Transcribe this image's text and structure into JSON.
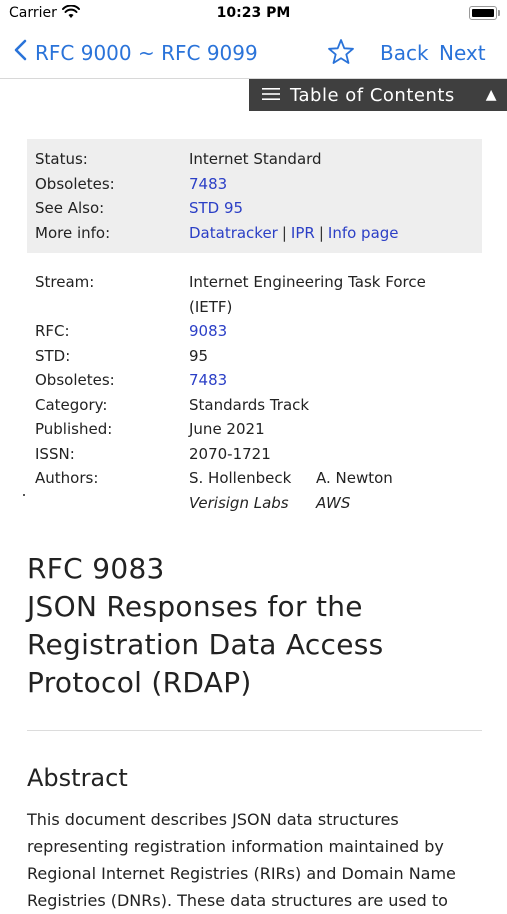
{
  "status_bar": {
    "carrier": "Carrier",
    "time": "10:23 PM"
  },
  "nav": {
    "range_title": "RFC 9000 ~ RFC 9099",
    "back": "Back",
    "next": "Next"
  },
  "toc": {
    "label": "Table of Contents"
  },
  "meta1": {
    "status_label": "Status:",
    "status_value": "Internet Standard",
    "obsoletes_label": "Obsoletes:",
    "obsoletes_value": "7483",
    "see_also_label": "See Also:",
    "see_also_value": "STD 95",
    "more_info_label": "More info:",
    "datatracker": "Datatracker",
    "ipr": "IPR",
    "info_page": "Info page",
    "separator": "|"
  },
  "meta2": {
    "stream_label": "Stream:",
    "stream_value_line1": "Internet Engineering Task Force",
    "stream_value_line2": "(IETF)",
    "rfc_label": "RFC:",
    "rfc_value": "9083",
    "std_label": "STD:",
    "std_value": "95",
    "obsoletes_label": "Obsoletes:",
    "obsoletes_value": "7483",
    "category_label": "Category:",
    "category_value": "Standards Track",
    "published_label": "Published:",
    "published_value": "June 2021",
    "issn_label": "ISSN:",
    "issn_value": "2070-1721",
    "authors_label": "Authors:",
    "authors": [
      {
        "name": "S. Hollenbeck",
        "org": "Verisign Labs"
      },
      {
        "name": "A. Newton",
        "org": "AWS"
      }
    ]
  },
  "doc": {
    "title_line1": "RFC 9083",
    "title_line2": "JSON Responses for the",
    "title_line3": "Registration Data Access",
    "title_line4": "Protocol (RDAP)",
    "abstract_heading": "Abstract",
    "abstract_text": "This document describes JSON data structures representing registration information maintained by Regional Internet Registries (RIRs) and Domain Name Registries (DNRs). These data structures are used to"
  },
  "colors": {
    "accent": "#2a73d9",
    "link": "#2b3fc6",
    "toc_bg": "#3f3f3f",
    "meta_bg": "#eeeeee"
  }
}
